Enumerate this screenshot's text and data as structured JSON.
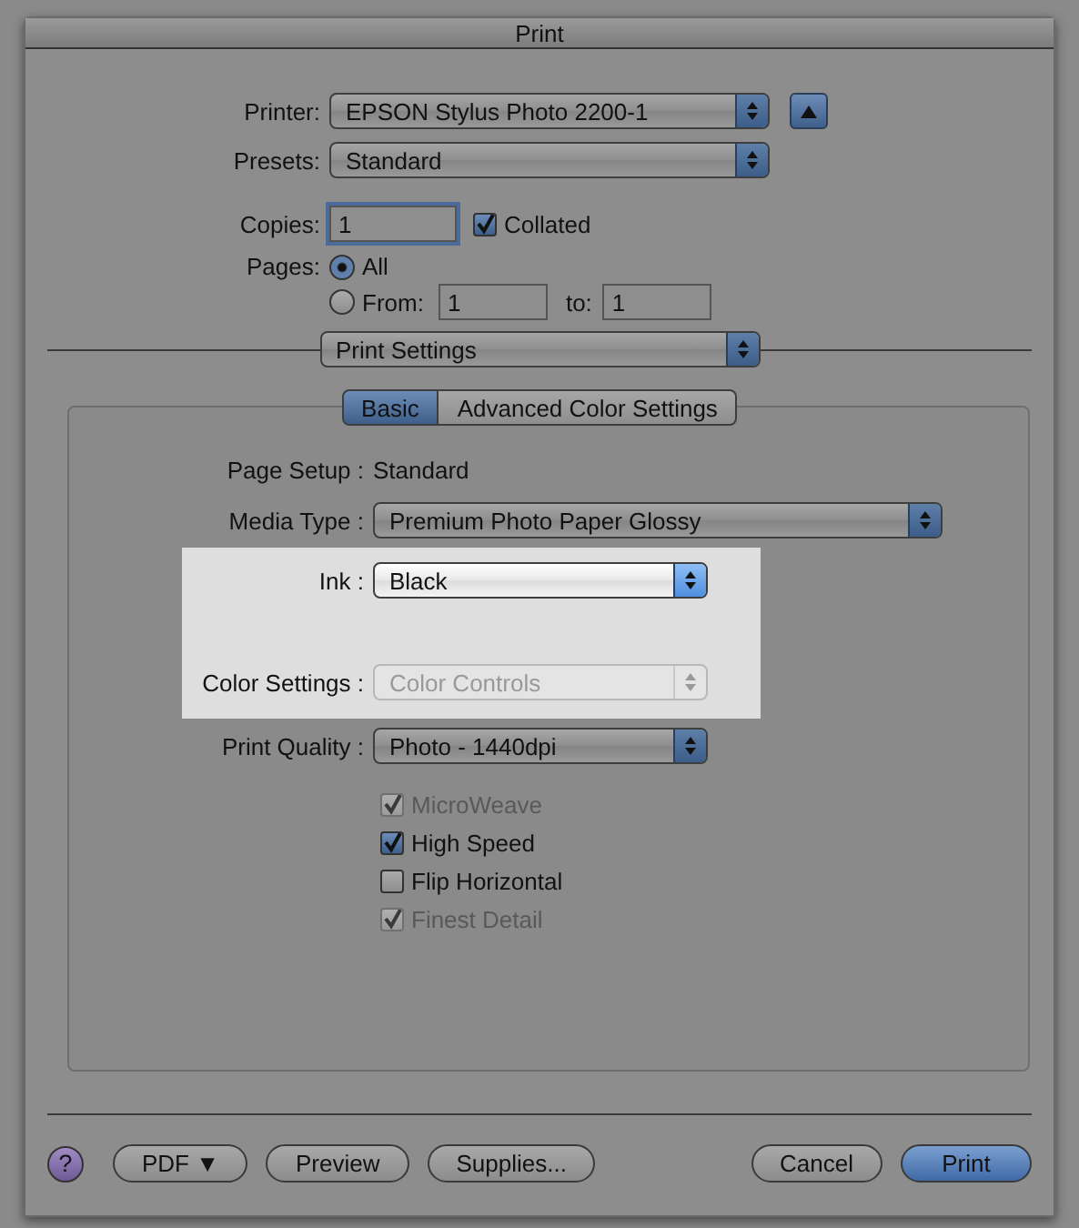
{
  "window": {
    "title": "Print"
  },
  "printer": {
    "label": "Printer:",
    "value": "EPSON Stylus Photo 2200-1",
    "expanded": false
  },
  "presets": {
    "label": "Presets:",
    "value": "Standard"
  },
  "copies": {
    "label": "Copies:",
    "value": "1"
  },
  "collated": {
    "label": "Collated",
    "checked": true
  },
  "pages": {
    "label": "Pages:",
    "options": [
      {
        "label": "All",
        "selected": true
      },
      {
        "label": "From:",
        "selected": false
      }
    ],
    "from": "1",
    "to_label": "to:",
    "to": "1"
  },
  "panel_menu": "Print Settings",
  "tabs": [
    {
      "label": "Basic",
      "selected": true
    },
    {
      "label": "Advanced Color Settings",
      "selected": false
    }
  ],
  "settings": [
    {
      "kind": "text",
      "label": "Page Setup :",
      "value": "Standard",
      "highlighted": false
    },
    {
      "kind": "popup",
      "label": "Media Type :",
      "value": "Premium Photo Paper Glossy",
      "highlighted": false,
      "disabled": false,
      "wide": true
    },
    {
      "kind": "popup",
      "label": "Ink :",
      "value": "Black",
      "highlighted": true,
      "disabled": false,
      "wide": false
    },
    {
      "kind": "popup",
      "label": "Color Settings :",
      "value": "Color Controls",
      "highlighted": true,
      "disabled": true,
      "wide": false
    },
    {
      "kind": "popup",
      "label": "Print Quality :",
      "value": "Photo - 1440dpi",
      "highlighted": false,
      "disabled": false,
      "wide": false
    }
  ],
  "options": [
    {
      "label": "MicroWeave",
      "checked": true,
      "disabled": true
    },
    {
      "label": "High Speed",
      "checked": true,
      "disabled": false
    },
    {
      "label": "Flip Horizontal",
      "checked": false,
      "disabled": false
    },
    {
      "label": "Finest Detail",
      "checked": true,
      "disabled": true
    }
  ],
  "help": "?",
  "buttons": [
    {
      "label": "PDF ▼",
      "kind": "left",
      "default": false
    },
    {
      "label": "Preview",
      "kind": "left",
      "default": false
    },
    {
      "label": "Supplies...",
      "kind": "left",
      "default": false
    },
    {
      "label": "Cancel",
      "kind": "right",
      "default": false
    },
    {
      "label": "Print",
      "kind": "right",
      "default": true
    }
  ]
}
